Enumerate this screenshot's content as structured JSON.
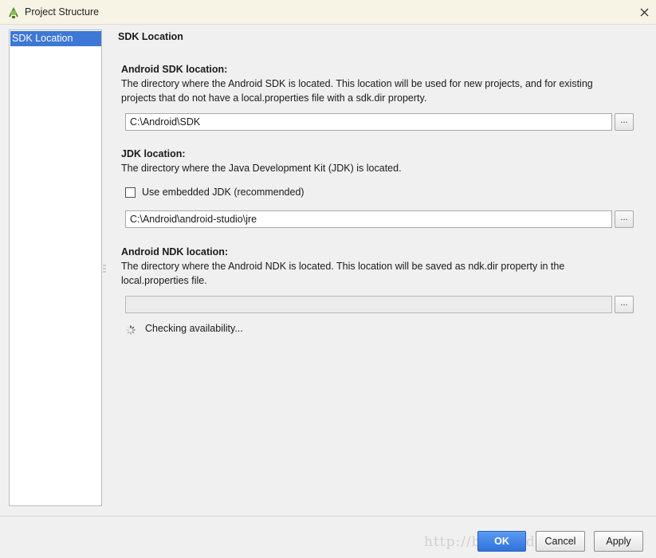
{
  "window": {
    "title": "Project Structure",
    "close_icon": "close-icon",
    "app_icon": "android-icon"
  },
  "sidebar": {
    "items": [
      {
        "label": "SDK Location",
        "selected": true
      }
    ]
  },
  "main": {
    "section_title": "SDK Location",
    "android_sdk": {
      "label": "Android SDK location:",
      "description_line1": "The directory where the Android SDK is located. This location will be used for new projects, and for existing",
      "description_line2": "projects that do not have a local.properties file with a sdk.dir property.",
      "value": "C:\\Android\\SDK",
      "browse_label": "..."
    },
    "jdk": {
      "label": "JDK location:",
      "description": "The directory where the Java Development Kit (JDK) is located.",
      "embedded_checkbox_label": "Use embedded JDK (recommended)",
      "embedded_checked": false,
      "value": "C:\\Android\\android-studio\\jre",
      "browse_label": "..."
    },
    "android_ndk": {
      "label": "Android NDK location:",
      "description_line1": "The directory where the Android NDK is located. This location will be saved as ndk.dir property in the",
      "description_line2": "local.properties file.",
      "value": "",
      "browse_label": "...",
      "status_text": "Checking availability..."
    }
  },
  "buttons": {
    "ok": "OK",
    "cancel": "Cancel",
    "apply": "Apply"
  },
  "watermark": "http://blog.csdn.net/",
  "colors": {
    "selection": "#3d78d6",
    "title_bar": "#f7f4e6",
    "ok_button": "#2f73dc"
  }
}
